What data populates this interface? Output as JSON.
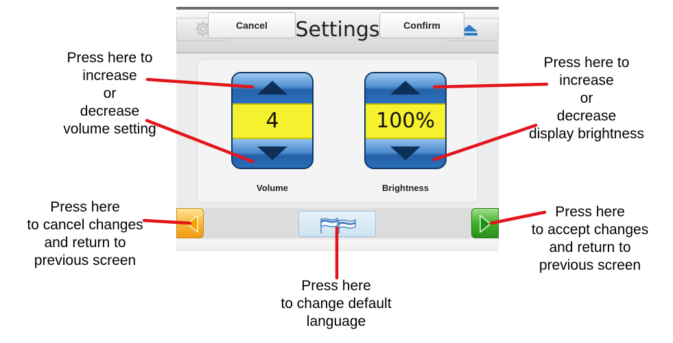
{
  "titlebar": {
    "title": "Settings",
    "settings_icon": "gear-icon",
    "eject_icon": "eject-icon"
  },
  "volume": {
    "value": "4",
    "label": "Volume",
    "up_icon": "triangle-up-icon",
    "down_icon": "triangle-down-icon"
  },
  "brightness": {
    "value": "100%",
    "label": "Brightness",
    "up_icon": "triangle-up-icon",
    "down_icon": "triangle-down-icon"
  },
  "bottombar": {
    "cancel_label": "Cancel",
    "confirm_label": "Confirm",
    "back_icon": "arrow-left-icon",
    "forward_icon": "arrow-right-icon",
    "language_icon": "flags-icon"
  },
  "annotations": {
    "volume": [
      "Press here to",
      "increase",
      "or",
      "decrease",
      "volume setting"
    ],
    "brightness": [
      "Press here to",
      "increase",
      "or",
      "decrease",
      "display brightness"
    ],
    "cancel": [
      "Press here",
      "to cancel changes",
      "and return to",
      "previous screen"
    ],
    "confirm": [
      "Press here",
      "to accept changes",
      "and return to",
      "previous screen"
    ],
    "language": [
      "Press here",
      "to change default",
      "language"
    ]
  },
  "colors": {
    "spinner_blue": "#2b6bb2",
    "value_yellow": "#f6f12e",
    "cancel_orange": "#f5b83a",
    "confirm_green": "#3eb12b",
    "callout_red": "#e3141b"
  }
}
